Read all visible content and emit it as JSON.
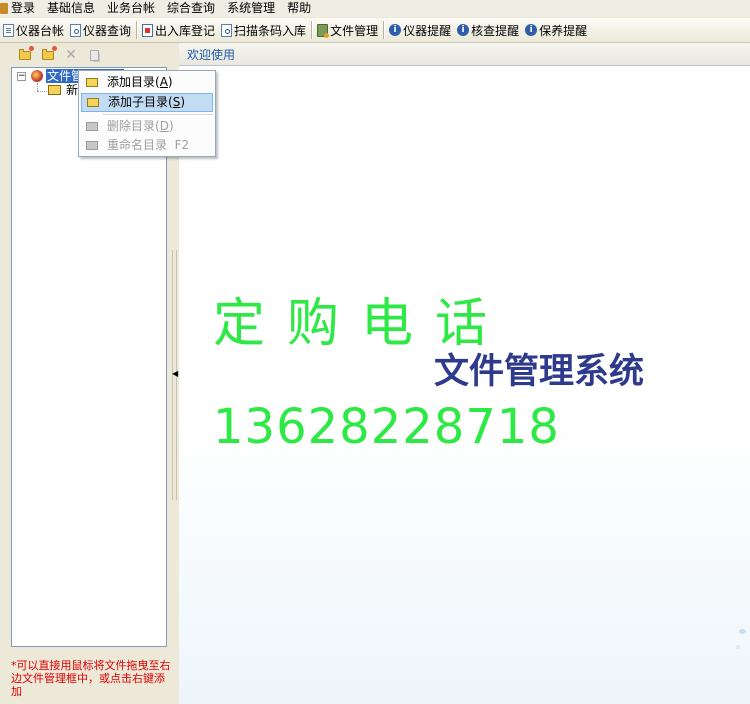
{
  "menubar": {
    "items": [
      "登录",
      "基础信息",
      "业务台帐",
      "综合查询",
      "系统管理",
      "帮助"
    ]
  },
  "toolbar": {
    "buttons": [
      {
        "label": "仪器台帐",
        "icon": "ledger-icon"
      },
      {
        "label": "仪器查询",
        "icon": "search-doc-icon"
      },
      {
        "label": "出入库登记",
        "icon": "stock-register-icon"
      },
      {
        "label": "扫描条码入库",
        "icon": "barcode-scan-icon"
      },
      {
        "label": "文件管理",
        "icon": "file-manager-icon"
      },
      {
        "label": "仪器提醒",
        "icon": "info-icon"
      },
      {
        "label": "核查提醒",
        "icon": "info-icon"
      },
      {
        "label": "保养提醒",
        "icon": "info-icon"
      }
    ]
  },
  "left_toolbar": {
    "icons": [
      "new-folder-icon",
      "new-subfolder-icon",
      "delete-icon",
      "copy-icon"
    ]
  },
  "tree": {
    "root_label": "文件管理目录",
    "child_label": "新建目录"
  },
  "context_menu": {
    "items": [
      {
        "label": "添加目录",
        "shortcut": "A",
        "enabled": true,
        "highlighted": false
      },
      {
        "label": "添加子目录",
        "shortcut": "S",
        "enabled": true,
        "highlighted": true
      },
      {
        "label": "删除目录",
        "shortcut": "D",
        "enabled": false,
        "highlighted": false
      },
      {
        "label": "重命名目录",
        "shortcut": "F2",
        "enabled": false,
        "highlighted": false
      }
    ]
  },
  "hint": {
    "text": "*可以直接用鼠标将文件拖曳至右边文件管理框中，或点击右键添加"
  },
  "main": {
    "tab_label": "欢迎使用",
    "promo_title": "定购电话",
    "app_title": "文件管理系统",
    "phone": "13628228718"
  },
  "colors": {
    "promo_green": "#2ee845",
    "app_title_navy": "#2e3a8c",
    "selection_blue": "#316ac5",
    "hint_red": "#e00000",
    "menu_highlight": "#c2dcf4"
  }
}
